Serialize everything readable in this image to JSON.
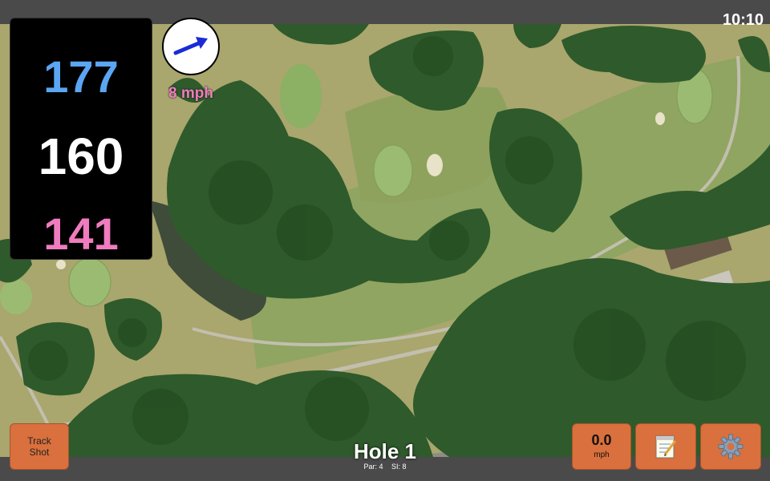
{
  "status": {
    "time": "10:10"
  },
  "distances": {
    "back": "177",
    "middle": "160",
    "front": "141"
  },
  "wind": {
    "speed": "8 mph",
    "direction_icon": "wind-arrow-icon"
  },
  "buttons": {
    "track_shot_line1": "Track",
    "track_shot_line2": "Shot",
    "speed_value": "0.0",
    "speed_unit": "mph",
    "notes_icon": "notepad-icon",
    "settings_icon": "gear-icon"
  },
  "hole": {
    "title": "Hole 1",
    "par": "Par: 4",
    "si": "SI: 8"
  },
  "colors": {
    "back": "#5aa6f2",
    "middle": "#ffffff",
    "front": "#f07cc0",
    "button": "#d9703d"
  }
}
